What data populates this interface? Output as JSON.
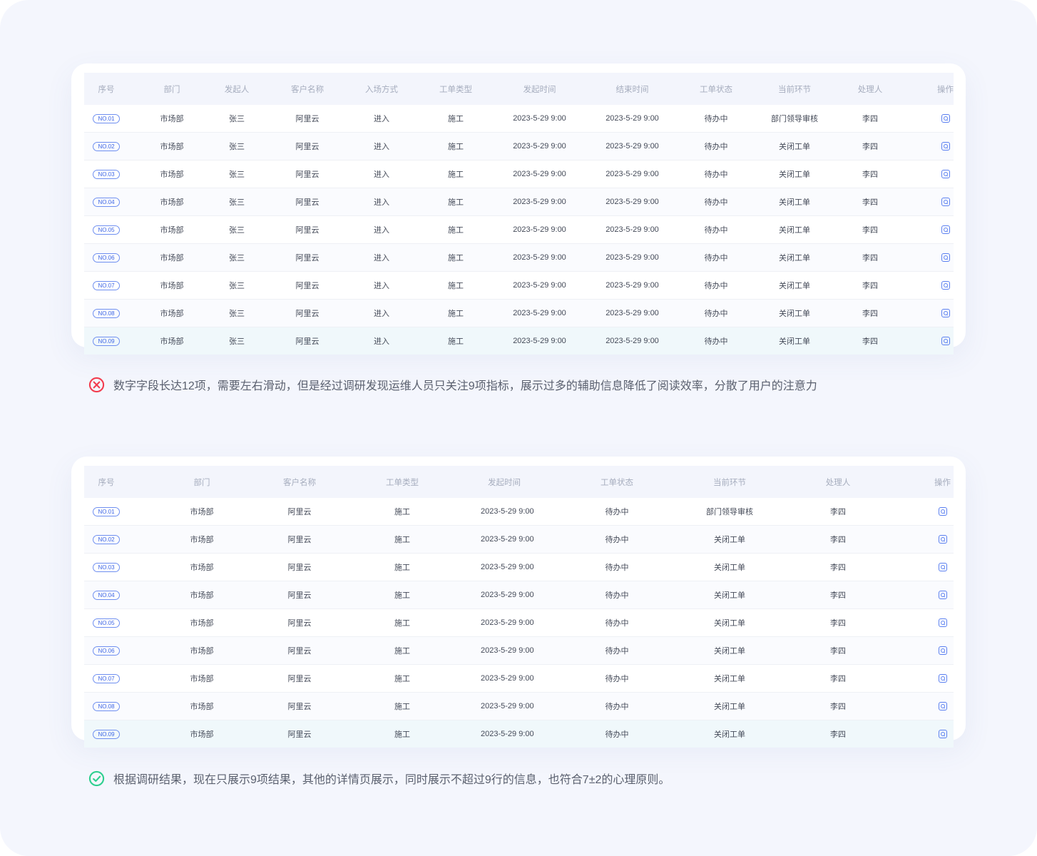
{
  "table_before": {
    "headers": [
      "序号",
      "部门",
      "发起人",
      "客户名称",
      "入场方式",
      "工单类型",
      "发起时间",
      "结束时间",
      "工单状态",
      "当前环节",
      "处理人",
      "操作"
    ],
    "rows": [
      [
        "NO.01",
        "市场部",
        "张三",
        "阿里云",
        "进入",
        "施工",
        "2023-5-29 9:00",
        "2023-5-29 9:00",
        "待办中",
        "部门领导审核",
        "李四"
      ],
      [
        "NO.02",
        "市场部",
        "张三",
        "阿里云",
        "进入",
        "施工",
        "2023-5-29 9:00",
        "2023-5-29 9:00",
        "待办中",
        "关闭工单",
        "李四"
      ],
      [
        "NO.03",
        "市场部",
        "张三",
        "阿里云",
        "进入",
        "施工",
        "2023-5-29 9:00",
        "2023-5-29 9:00",
        "待办中",
        "关闭工单",
        "李四"
      ],
      [
        "NO.04",
        "市场部",
        "张三",
        "阿里云",
        "进入",
        "施工",
        "2023-5-29 9:00",
        "2023-5-29 9:00",
        "待办中",
        "关闭工单",
        "李四"
      ],
      [
        "NO.05",
        "市场部",
        "张三",
        "阿里云",
        "进入",
        "施工",
        "2023-5-29 9:00",
        "2023-5-29 9:00",
        "待办中",
        "关闭工单",
        "李四"
      ],
      [
        "NO.06",
        "市场部",
        "张三",
        "阿里云",
        "进入",
        "施工",
        "2023-5-29 9:00",
        "2023-5-29 9:00",
        "待办中",
        "关闭工单",
        "李四"
      ],
      [
        "NO.07",
        "市场部",
        "张三",
        "阿里云",
        "进入",
        "施工",
        "2023-5-29 9:00",
        "2023-5-29 9:00",
        "待办中",
        "关闭工单",
        "李四"
      ],
      [
        "NO.08",
        "市场部",
        "张三",
        "阿里云",
        "进入",
        "施工",
        "2023-5-29 9:00",
        "2023-5-29 9:00",
        "待办中",
        "关闭工单",
        "李四"
      ],
      [
        "NO.09",
        "市场部",
        "张三",
        "阿里云",
        "进入",
        "施工",
        "2023-5-29 9:00",
        "2023-5-29 9:00",
        "待办中",
        "关闭工单",
        "李四"
      ]
    ],
    "action_icon": "view-icon",
    "highlighted_row": 8
  },
  "note_before": {
    "icon": "error-circle-icon",
    "icon_color": "#f23d4f",
    "text": "数字字段长达12项，需要左右滑动，但是经过调研发现运维人员只关注9项指标，展示过多的辅助信息降低了阅读效率，分散了用户的注意力"
  },
  "table_after": {
    "headers": [
      "序号",
      "部门",
      "客户名称",
      "工单类型",
      "发起时间",
      "工单状态",
      "当前环节",
      "处理人",
      "操作"
    ],
    "rows": [
      [
        "NO.01",
        "市场部",
        "阿里云",
        "施工",
        "2023-5-29 9:00",
        "待办中",
        "部门领导审核",
        "李四"
      ],
      [
        "NO.02",
        "市场部",
        "阿里云",
        "施工",
        "2023-5-29 9:00",
        "待办中",
        "关闭工单",
        "李四"
      ],
      [
        "NO.03",
        "市场部",
        "阿里云",
        "施工",
        "2023-5-29 9:00",
        "待办中",
        "关闭工单",
        "李四"
      ],
      [
        "NO.04",
        "市场部",
        "阿里云",
        "施工",
        "2023-5-29 9:00",
        "待办中",
        "关闭工单",
        "李四"
      ],
      [
        "NO.05",
        "市场部",
        "阿里云",
        "施工",
        "2023-5-29 9:00",
        "待办中",
        "关闭工单",
        "李四"
      ],
      [
        "NO.06",
        "市场部",
        "阿里云",
        "施工",
        "2023-5-29 9:00",
        "待办中",
        "关闭工单",
        "李四"
      ],
      [
        "NO.07",
        "市场部",
        "阿里云",
        "施工",
        "2023-5-29 9:00",
        "待办中",
        "关闭工单",
        "李四"
      ],
      [
        "NO.08",
        "市场部",
        "阿里云",
        "施工",
        "2023-5-29 9:00",
        "待办中",
        "关闭工单",
        "李四"
      ],
      [
        "NO.09",
        "市场部",
        "阿里云",
        "施工",
        "2023-5-29 9:00",
        "待办中",
        "关闭工单",
        "李四"
      ]
    ],
    "action_icon": "view-icon",
    "highlighted_row": 8
  },
  "note_after": {
    "icon": "check-circle-icon",
    "icon_color": "#2ecf8f",
    "text": "根据调研结果，现在只展示9项结果，其他的详情页展示，同时展示不超过9行的信息，也符合7±2的心理原则。"
  },
  "colors": {
    "background": "#f4f6fd",
    "accent": "#3f67e6",
    "header_bg": "#f3f5fc",
    "highlight_row": "#f0f8fb"
  }
}
